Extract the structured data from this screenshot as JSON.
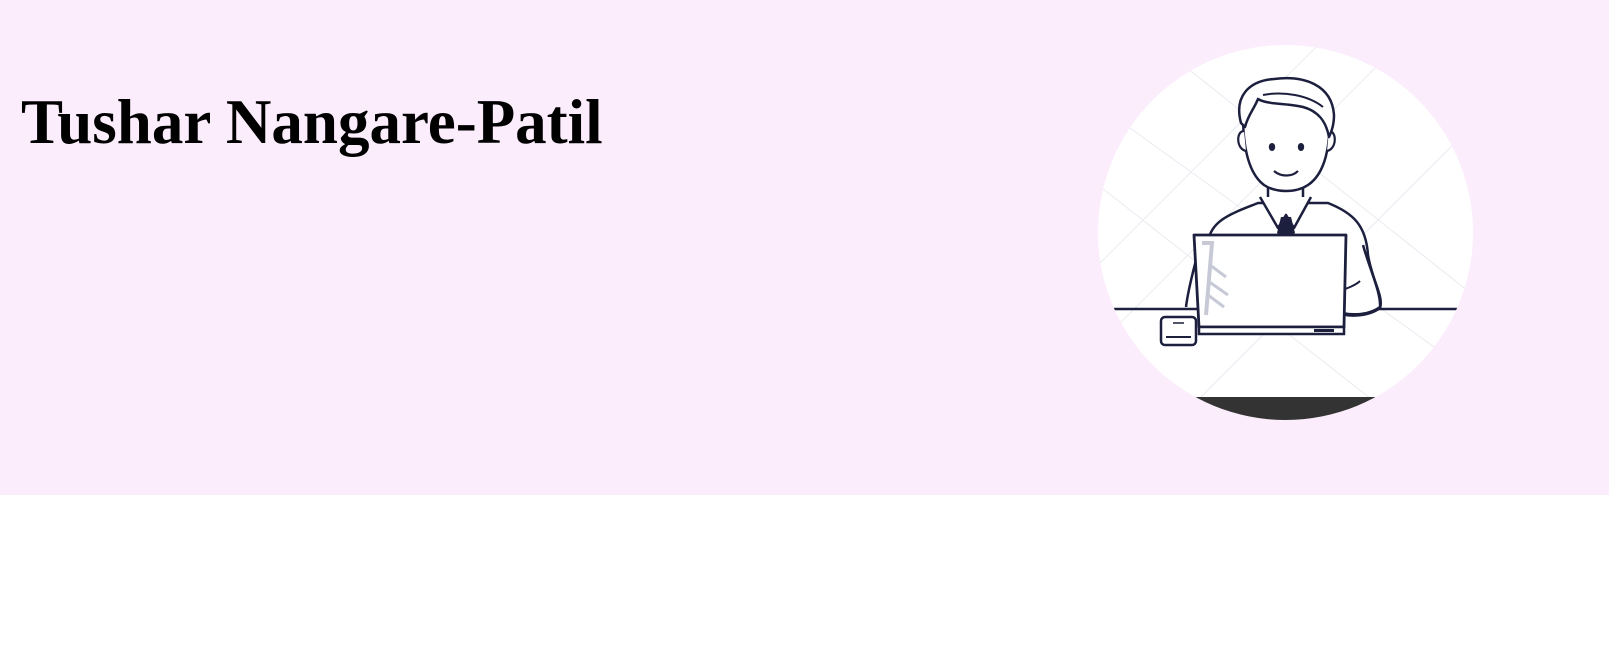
{
  "profile": {
    "name": "Tushar Nangare-Patil",
    "avatar_icon": "developer-at-laptop-illustration-icon"
  },
  "colors": {
    "hero_background": "#fcedfd",
    "page_background": "#ffffff",
    "ink": "#1c1f3d",
    "avatar_footer": "#333333"
  }
}
